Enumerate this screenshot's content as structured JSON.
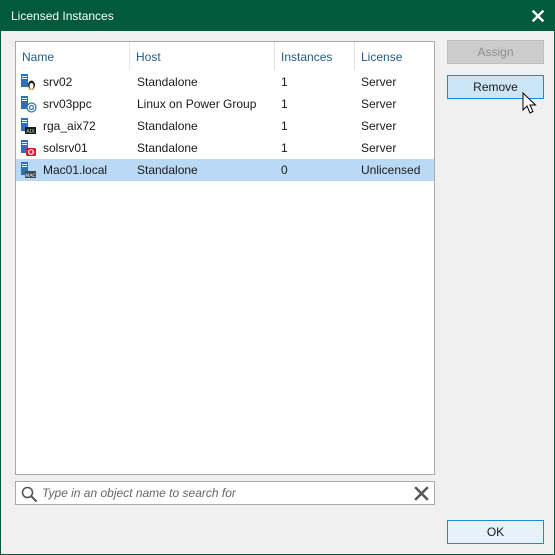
{
  "window": {
    "title": "Licensed Instances"
  },
  "table": {
    "columns": [
      "Name",
      "Host",
      "Instances",
      "License"
    ],
    "rows": [
      {
        "name": "srv02",
        "host": "Standalone",
        "instances": "1",
        "license": "Server",
        "icon": "linux-server-icon"
      },
      {
        "name": "srv03ppc",
        "host": "Linux on Power Group",
        "instances": "1",
        "license": "Server",
        "icon": "linux-power-server-icon"
      },
      {
        "name": "rga_aix72",
        "host": "Standalone",
        "instances": "1",
        "license": "Server",
        "icon": "aix-server-icon"
      },
      {
        "name": "solsrv01",
        "host": "Standalone",
        "instances": "1",
        "license": "Server",
        "icon": "solaris-server-icon"
      },
      {
        "name": "Mac01.local",
        "host": "Standalone",
        "instances": "0",
        "license": "Unlicensed",
        "icon": "mac-server-icon"
      }
    ],
    "selected_row_index": 4
  },
  "search": {
    "placeholder": "Type in an object name to search for",
    "value": ""
  },
  "buttons": {
    "assign": "Assign",
    "remove": "Remove",
    "ok": "OK"
  },
  "colors": {
    "titlebar": "#005a3c",
    "header_text": "#1f5c8a",
    "selection": "#b9d9f5"
  }
}
